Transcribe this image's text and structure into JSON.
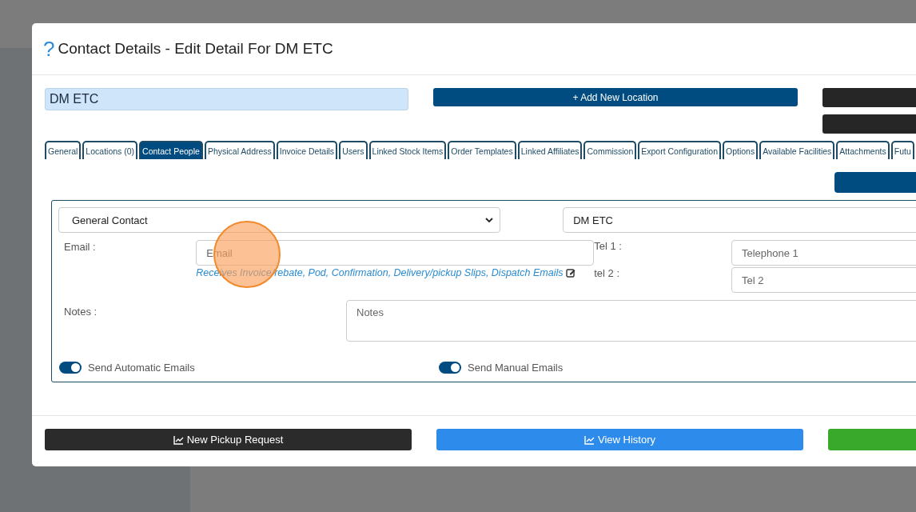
{
  "dialog": {
    "help_mark": "?",
    "title": "Contact Details - Edit Detail For DM ETC",
    "name_field": {
      "value": "DM ETC"
    },
    "add_location_button": "+ Add New Location",
    "tabs": [
      {
        "label": "General",
        "selected": false
      },
      {
        "label": "Locations (0)",
        "selected": false
      },
      {
        "label": "Contact People",
        "selected": true
      },
      {
        "label": "Physical Address",
        "selected": false
      },
      {
        "label": "Invoice Details",
        "selected": false
      },
      {
        "label": "Users",
        "selected": false
      },
      {
        "label": "Linked Stock Items",
        "selected": false
      },
      {
        "label": "Order Templates",
        "selected": false
      },
      {
        "label": "Linked Affiliates",
        "selected": false
      },
      {
        "label": "Commission",
        "selected": false
      },
      {
        "label": "Export Configuration",
        "selected": false
      },
      {
        "label": "Options",
        "selected": false
      },
      {
        "label": "Available Facilities",
        "selected": false
      },
      {
        "label": "Attachments",
        "selected": false
      },
      {
        "label": "Futu",
        "selected": false
      }
    ],
    "contact": {
      "type_select": {
        "value": "General Contact"
      },
      "name_field": {
        "value": "DM ETC"
      },
      "email": {
        "label": "Email :",
        "placeholder": "Email"
      },
      "receives_link": "Receives Invoice/rebate, Pod, Confirmation, Delivery/pickup Slips, Dispatch Emails",
      "tel_1": {
        "label": "Tel 1 :",
        "placeholder": "Telephone 1"
      },
      "tel_2": {
        "label": "tel 2 :",
        "placeholder": "Tel 2"
      },
      "notes": {
        "label": "Notes :",
        "placeholder": "Notes"
      },
      "toggles": [
        {
          "label": "Send Automatic Emails",
          "on": true
        },
        {
          "label": "Send Manual Emails",
          "on": true
        }
      ]
    },
    "footer_buttons": [
      {
        "label": "New Pickup Request",
        "kind": "dark"
      },
      {
        "label": "View History",
        "kind": "primary"
      },
      {
        "kind": "success"
      }
    ]
  }
}
